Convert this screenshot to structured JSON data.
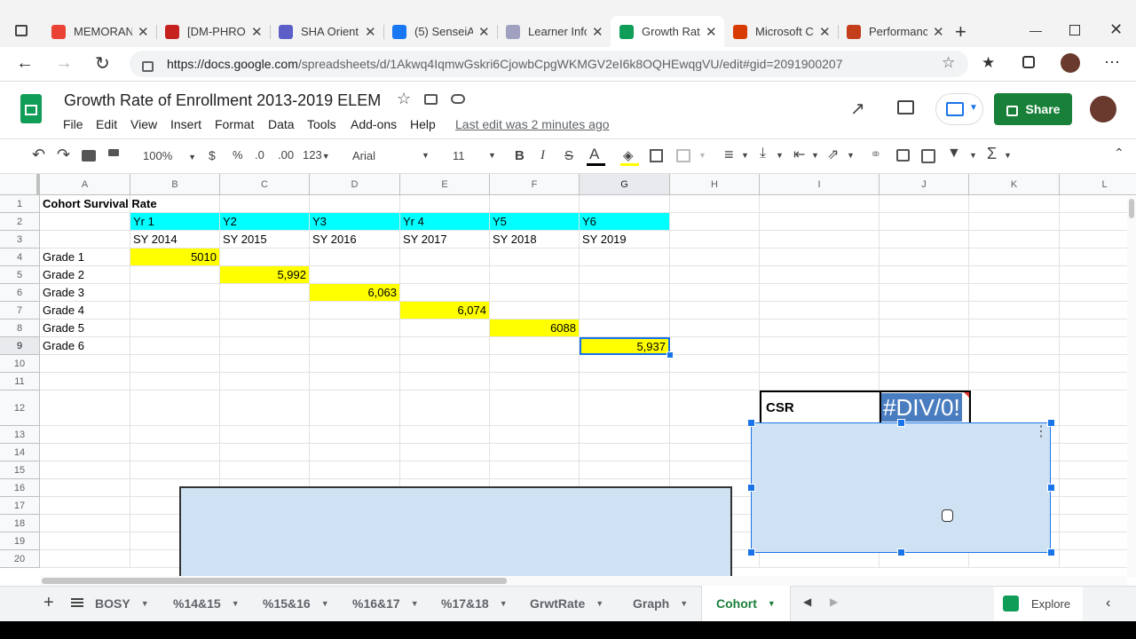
{
  "browser": {
    "tabs": [
      {
        "label": "MEMORAN",
        "color": "#ea4335"
      },
      {
        "label": "[DM-PHROI",
        "color": "#c5221f"
      },
      {
        "label": "SHA Orient",
        "color": "#5b5fc7"
      },
      {
        "label": "(5) SenseiA",
        "color": "#1877f2"
      },
      {
        "label": "Learner Info",
        "color": "#a0a0c0"
      },
      {
        "label": "Growth Rat",
        "color": "#0f9d58"
      },
      {
        "label": "Microsoft C",
        "color": "#d83b01"
      },
      {
        "label": "Performanc",
        "color": "#c43e1c"
      }
    ],
    "url_host": "https://docs.google.com",
    "url_path": "/spreadsheets/d/1Akwq4IqmwGskri6CjowbCpgWKMGV2eI6k8OQHEwqgVU/edit#gid=2091900207"
  },
  "sheets": {
    "title": "Growth Rate of Enrollment 2013-2019 ELEM",
    "menus": [
      "File",
      "Edit",
      "View",
      "Insert",
      "Format",
      "Data",
      "Tools",
      "Add-ons",
      "Help"
    ],
    "last_edit": "Last edit was 2 minutes ago",
    "share_label": "Share",
    "toolbar": {
      "zoom": "100%",
      "currency": "$",
      "percent": "%",
      "dec_less": ".0",
      "dec_more": ".00",
      "format_more": "123",
      "font": "Arial",
      "font_size": "11",
      "bold": "B",
      "italic": "I",
      "strike": "S",
      "text_color": "A"
    }
  },
  "grid": {
    "columns": [
      "A",
      "B",
      "C",
      "D",
      "E",
      "F",
      "G",
      "H",
      "I",
      "J",
      "K",
      "L"
    ],
    "rows": [
      "1",
      "2",
      "3",
      "4",
      "5",
      "6",
      "7",
      "8",
      "9",
      "10",
      "11",
      "12",
      "13",
      "14",
      "15",
      "16",
      "17",
      "18",
      "19",
      "20"
    ],
    "a1": "Cohort Survival Rate",
    "years": [
      "Yr 1",
      "Y2",
      "Y3",
      "Yr 4",
      "Y5",
      "Y6"
    ],
    "school_years": [
      "SY 2014",
      "SY 2015",
      "SY 2016",
      "SY 2017",
      "SY 2018",
      "SY 2019"
    ],
    "grades": [
      "Grade 1",
      "Grade 2",
      "Grade 3",
      "Grade 4",
      "Grade 5",
      "Grade 6"
    ],
    "values": [
      "5010",
      "5,992",
      "6,063",
      "6,074",
      "6088",
      "5,937"
    ],
    "csr_label": "CSR",
    "csr_value": "#DIV/0!",
    "colors": {
      "header_fill": "#00ffff",
      "value_fill": "#ffff00",
      "selected_border": "#1a73e8"
    }
  },
  "sheet_tabs": [
    "BOSY",
    "%14&15",
    "%15&16",
    "%16&17",
    "%17&18",
    "GrwtRate",
    "Graph",
    "Cohort"
  ],
  "active_sheet_tab": "Cohort",
  "explore_label": "Explore"
}
